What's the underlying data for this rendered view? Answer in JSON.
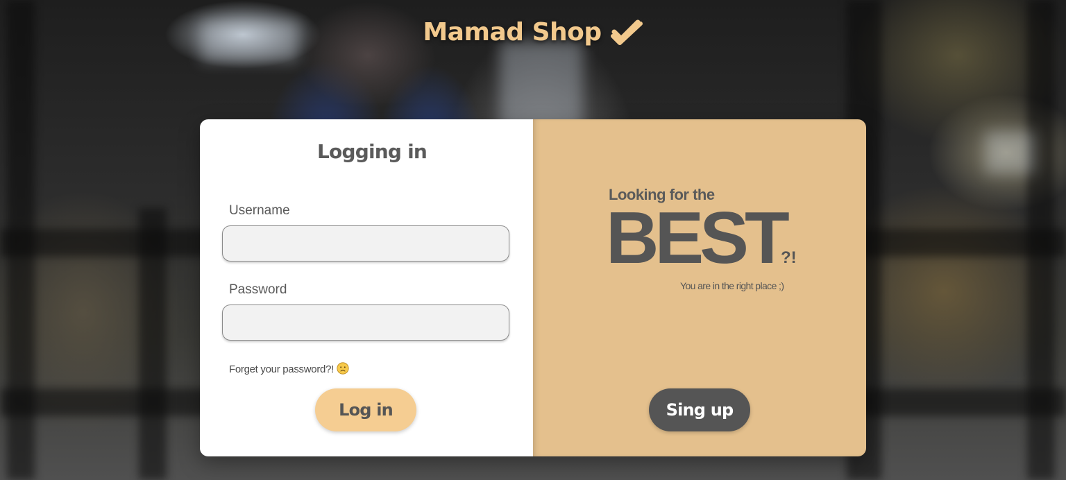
{
  "logo": {
    "text": "Mamad Shop",
    "icon": "double-check-icon",
    "color": "#f2c98d"
  },
  "login": {
    "title": "Logging in",
    "username_label": "Username",
    "username_value": "",
    "password_label": "Password",
    "password_value": "",
    "forgot_text": "Forget your password?!",
    "forgot_icon": "sad-face-icon",
    "submit_label": "Log in"
  },
  "promo": {
    "top_text": "Looking for the",
    "big_text": "BEST",
    "punct": "?!",
    "sub_text": "You are in the right place ;)",
    "signup_label": "Sing up"
  },
  "colors": {
    "accent": "#f5cd92",
    "panel": "#e4c08d",
    "text": "#555555",
    "signup_bg": "#555555"
  }
}
